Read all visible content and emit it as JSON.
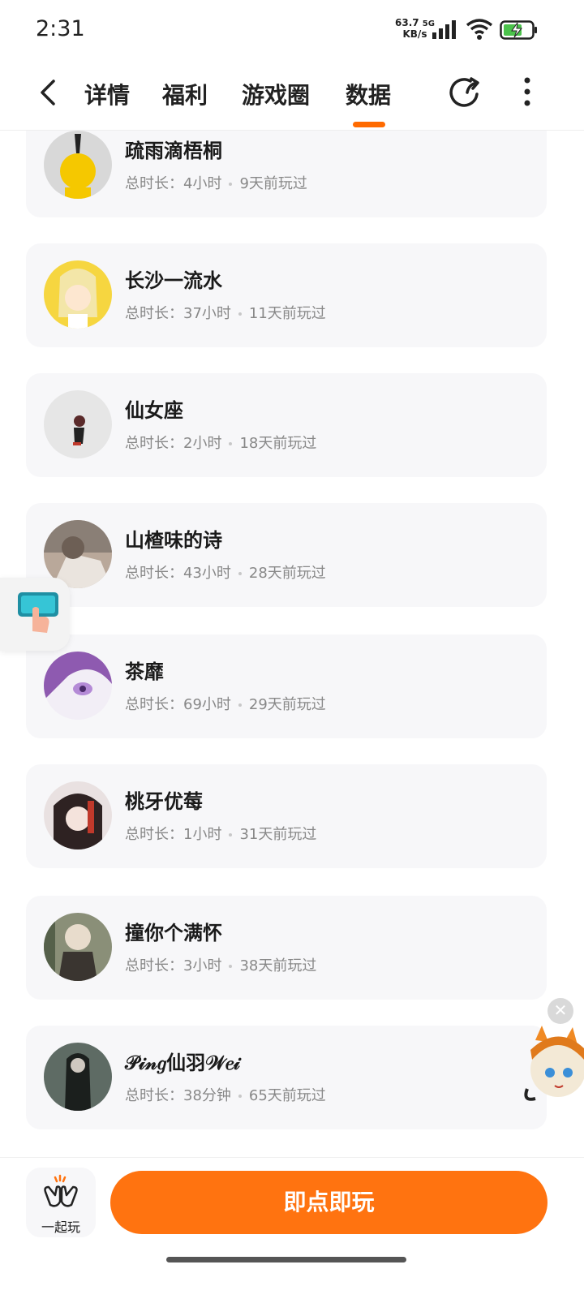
{
  "status_bar": {
    "time": "2:31",
    "speed_value": "63.7",
    "speed_unit": "KB/s",
    "network": "5G",
    "icons": [
      "signal-icon",
      "wifi-icon",
      "battery-charging-icon"
    ]
  },
  "header": {
    "tabs": [
      {
        "label": "详情"
      },
      {
        "label": "福利"
      },
      {
        "label": "游戏圈"
      },
      {
        "label": "数据"
      }
    ],
    "active_tab": "数据",
    "accent_color": "#ff6a00"
  },
  "players": [
    {
      "name": "疏雨滴梧桐",
      "duration_label": "总时长：",
      "duration": "4小时",
      "last_played": "9天前玩过",
      "avatar_color": "#d8d8d8"
    },
    {
      "name": "长沙一流水",
      "duration_label": "总时长：",
      "duration": "37小时",
      "last_played": "11天前玩过",
      "avatar_color": "#f6d640"
    },
    {
      "name": "仙女座",
      "duration_label": "总时长：",
      "duration": "2小时",
      "last_played": "18天前玩过",
      "avatar_color": "#e6e6e6"
    },
    {
      "name": "山楂味的诗",
      "duration_label": "总时长：",
      "duration": "43小时",
      "last_played": "28天前玩过",
      "avatar_color": "#b9a89a"
    },
    {
      "name": "茶靡",
      "duration_label": "总时长：",
      "duration": "69小时",
      "last_played": "29天前玩过",
      "avatar_color": "#a678c8"
    },
    {
      "name": "桃牙优莓",
      "duration_label": "总时长：",
      "duration": "1小时",
      "last_played": "31天前玩过",
      "avatar_color": "#7a4a4a"
    },
    {
      "name": "撞你个满怀",
      "duration_label": "总时长：",
      "duration": "3小时",
      "last_played": "38天前玩过",
      "avatar_color": "#8a8f78"
    },
    {
      "name": "𝒫𝒾𝓃𝑔仙羽𝒲𝑒𝒾",
      "duration_label": "总时长：",
      "duration": "38分钟",
      "last_played": "65天前玩过",
      "avatar_color": "#3c4a44"
    }
  ],
  "bottom_bar": {
    "together_label": "一起玩",
    "play_button": "即点即玩",
    "play_color": "#ff7310"
  }
}
